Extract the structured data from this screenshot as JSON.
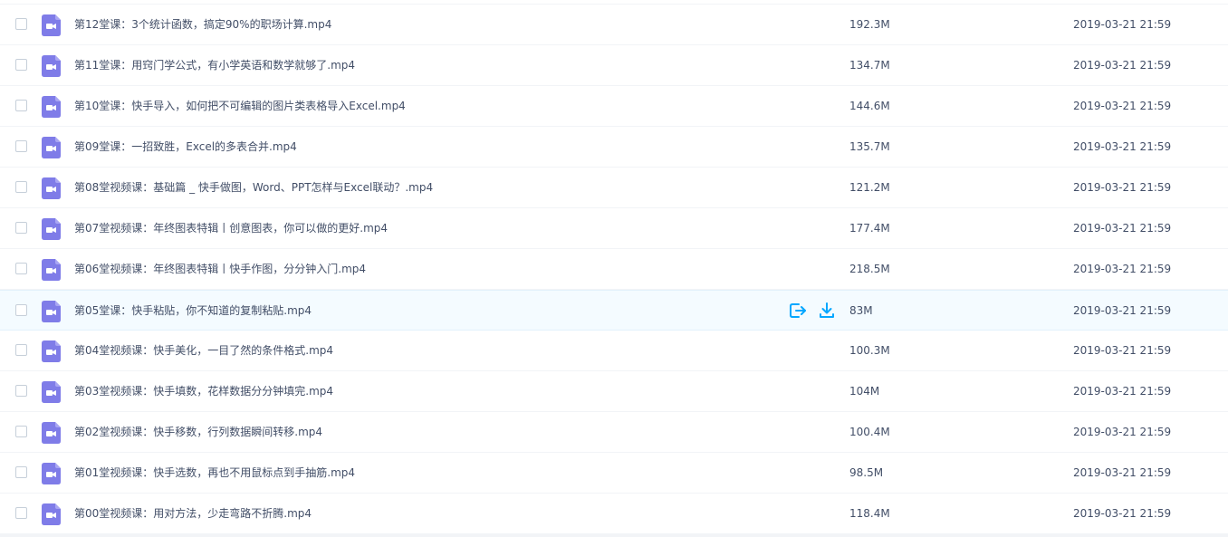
{
  "colors": {
    "accent": "#06a7ff",
    "video_icon": "#7f7ce8",
    "hover_row": "#f4fbff",
    "text": "#424e67"
  },
  "files": [
    {
      "name": "第12堂课：3个统计函数，搞定90%的职场计算.mp4",
      "size": "192.3M",
      "date": "2019-03-21 21:59",
      "icon": "video-file-icon"
    },
    {
      "name": "第11堂课：用窍门学公式，有小学英语和数学就够了.mp4",
      "size": "134.7M",
      "date": "2019-03-21 21:59",
      "icon": "video-file-icon"
    },
    {
      "name": "第10堂课：快手导入，如何把不可编辑的图片类表格导入Excel.mp4",
      "size": "144.6M",
      "date": "2019-03-21 21:59",
      "icon": "video-file-icon"
    },
    {
      "name": "第09堂课：一招致胜，Excel的多表合并.mp4",
      "size": "135.7M",
      "date": "2019-03-21 21:59",
      "icon": "video-file-icon"
    },
    {
      "name": "第08堂视频课：基础篇 _ 快手做图，Word、PPT怎样与Excel联动？.mp4",
      "size": "121.2M",
      "date": "2019-03-21 21:59",
      "icon": "video-file-icon"
    },
    {
      "name": "第07堂视频课：年终图表特辑丨创意图表，你可以做的更好.mp4",
      "size": "177.4M",
      "date": "2019-03-21 21:59",
      "icon": "video-file-icon"
    },
    {
      "name": "第06堂视频课：年终图表特辑丨快手作图，分分钟入门.mp4",
      "size": "218.5M",
      "date": "2019-03-21 21:59",
      "icon": "video-file-icon"
    },
    {
      "name": "第05堂课：快手粘贴，你不知道的复制粘贴.mp4",
      "size": "83M",
      "date": "2019-03-21 21:59",
      "icon": "video-file-icon",
      "hover": true
    },
    {
      "name": "第04堂视频课：快手美化，一目了然的条件格式.mp4",
      "size": "100.3M",
      "date": "2019-03-21 21:59",
      "icon": "video-file-icon"
    },
    {
      "name": "第03堂视频课：快手填数，花样数据分分钟填完.mp4",
      "size": "104M",
      "date": "2019-03-21 21:59",
      "icon": "video-file-icon"
    },
    {
      "name": "第02堂视频课：快手移数，行列数据瞬间转移.mp4",
      "size": "100.4M",
      "date": "2019-03-21 21:59",
      "icon": "video-file-icon"
    },
    {
      "name": "第01堂视频课：快手选数，再也不用鼠标点到手抽筋.mp4",
      "size": "98.5M",
      "date": "2019-03-21 21:59",
      "icon": "video-file-icon"
    },
    {
      "name": "第00堂视频课：用对方法，少走弯路不折腾.mp4",
      "size": "118.4M",
      "date": "2019-03-21 21:59",
      "icon": "video-file-icon"
    }
  ],
  "row_actions": {
    "share_icon": "share-icon",
    "download_icon": "download-icon"
  }
}
